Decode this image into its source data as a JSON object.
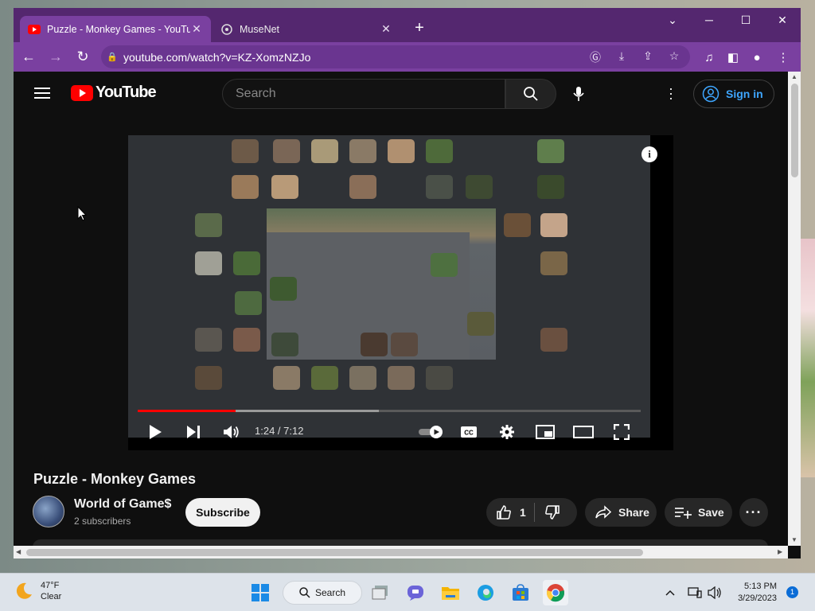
{
  "browser": {
    "tabs": [
      {
        "label": "Puzzle - Monkey Games - YouTube",
        "active": true
      },
      {
        "label": "MuseNet",
        "active": false
      }
    ],
    "url": "youtube.com/watch?v=KZ-XomzNZJo",
    "accent": "#7a40a0"
  },
  "youtube": {
    "logo_text": "YouTube",
    "search_placeholder": "Search",
    "sign_in_label": "Sign in"
  },
  "video": {
    "title": "Puzzle - Monkey Games",
    "time_display": "1:24 / 7:12",
    "progress_fraction": 0.194,
    "buffered_fraction": 0.48
  },
  "channel": {
    "name": "World of Game$",
    "subscribers": "2 subscribers",
    "subscribe_label": "Subscribe"
  },
  "actions": {
    "like_count": "1",
    "share_label": "Share",
    "save_label": "Save"
  },
  "taskbar": {
    "temperature": "47°F",
    "condition": "Clear",
    "search_label": "Search",
    "time": "5:13 PM",
    "date": "3/29/2023",
    "notification_count": "1"
  }
}
